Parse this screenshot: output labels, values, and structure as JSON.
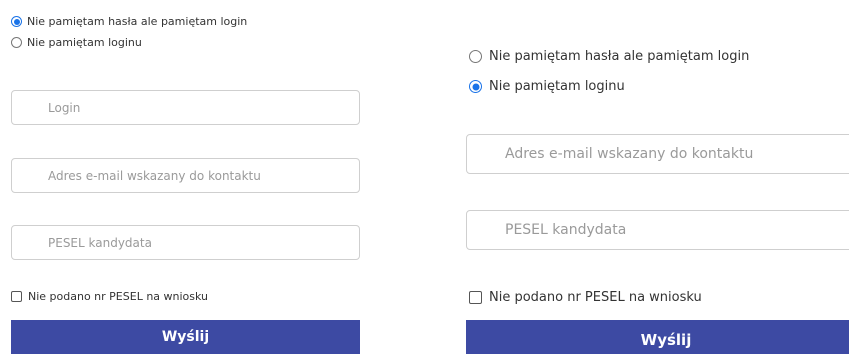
{
  "left_form": {
    "options": [
      {
        "label": "Nie pamiętam hasła ale pamiętam login",
        "selected": true
      },
      {
        "label": "Nie pamiętam loginu",
        "selected": false
      }
    ],
    "login_placeholder": "Login",
    "email_placeholder": "Adres e-mail wskazany do kontaktu",
    "pesel_placeholder": "PESEL kandydata",
    "no_pesel_label": "Nie podano nr PESEL na wniosku",
    "no_pesel_checked": false,
    "submit_label": "Wyślij"
  },
  "right_form": {
    "options": [
      {
        "label": "Nie pamiętam hasła ale pamiętam login",
        "selected": false
      },
      {
        "label": "Nie pamiętam loginu",
        "selected": true
      }
    ],
    "email_placeholder": "Adres e-mail wskazany do kontaktu",
    "pesel_placeholder": "PESEL kandydata",
    "no_pesel_label": "Nie podano nr PESEL na wniosku",
    "no_pesel_checked": false,
    "submit_label": "Wyślij"
  },
  "colors": {
    "accent": "#1a73e8",
    "button": "#3d4aa3",
    "border": "#cfcfcf"
  }
}
